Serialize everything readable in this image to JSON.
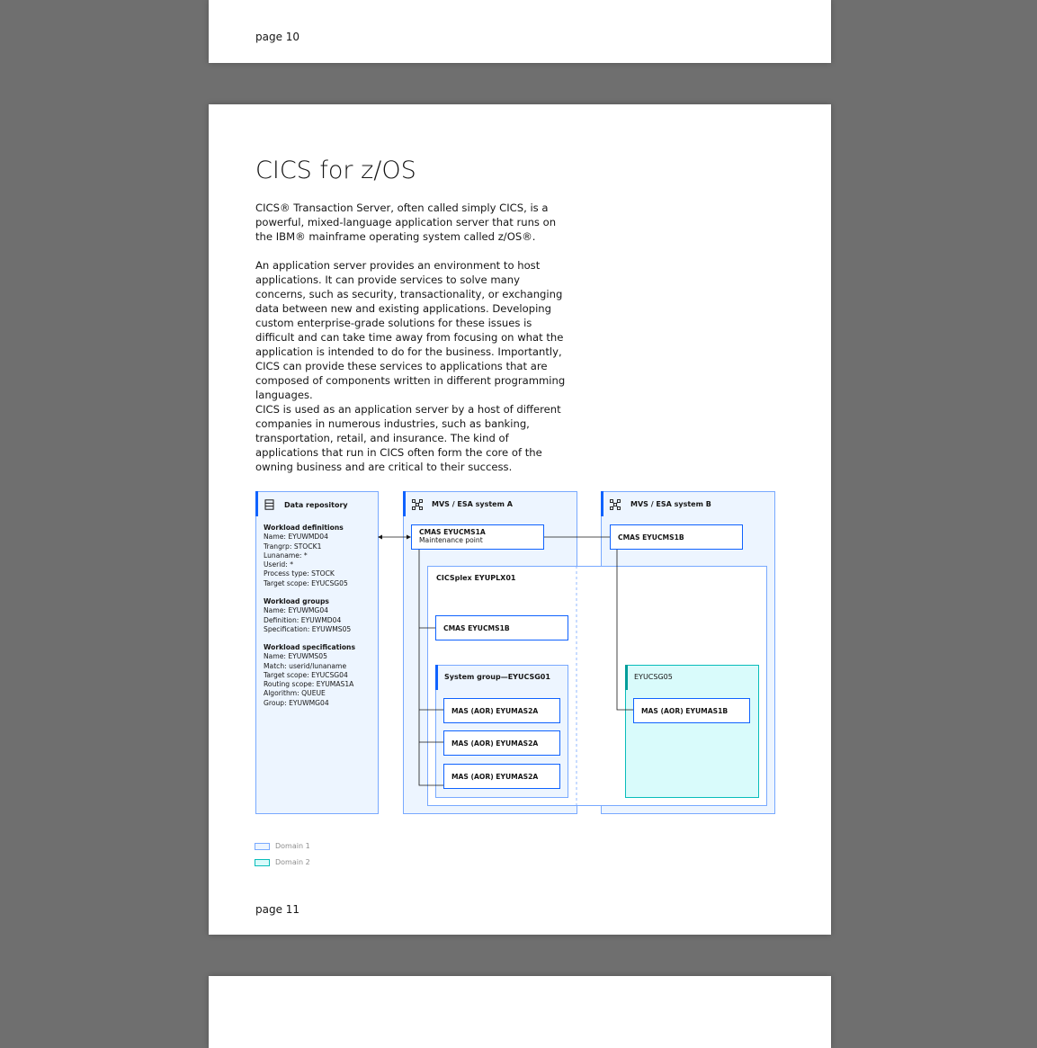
{
  "pages": {
    "prev_label": "page 10",
    "main_label": "page 11"
  },
  "doc": {
    "title": "CICS for z/OS",
    "paragraphs": [
      "CICS® Transaction Server, often called simply CICS, is a powerful, mixed-language application server that runs on the IBM® mainframe operating system called z/OS®.",
      "An application server provides an environment to host applications. It can provide services to solve many concerns, such as security, transactionality, or exchanging data between new and existing applications. Developing custom enterprise-grade solutions for these issues is difficult and can take time away from focusing on what the application is intended to do for the business. Importantly, CICS can provide these services to applications that are composed of components written in different programming languages.",
      "CICS is used as an application server by a host of different companies in numerous industries, such as banking, transportation, retail, and insurance. The kind of applications that run in CICS often form the core of the owning business and are critical to their success."
    ]
  },
  "diagram": {
    "repo": {
      "title": "Data repository",
      "icon": "database-icon",
      "sections": [
        {
          "heading": "Workload definitions",
          "lines": [
            "Name: EYUWMD04",
            "Trangrp: STOCK1",
            "Lunaname: *",
            "Userid: *",
            "Process type: STOCK",
            "Target scope: EYUCSG05"
          ]
        },
        {
          "heading": "Workload groups",
          "lines": [
            "Name: EYUWMG04",
            "Definition: EYUWMD04",
            "Specification: EYUWMS05"
          ]
        },
        {
          "heading": "Workload specifications",
          "lines": [
            "Name: EYUWMS05",
            "Match: userid/lunaname",
            "Target scope: EYUCSG04",
            "Routing scope: EYUMAS1A",
            "Algorithm: QUEUE",
            "Group: EYUWMG04"
          ]
        }
      ]
    },
    "system_a": {
      "title": "MVS / ESA system A",
      "icon": "network-icon",
      "cmas_name": "CMAS EYUCMS1A",
      "cmas_sub": "Maintenance point"
    },
    "system_b": {
      "title": "MVS / ESA system B",
      "icon": "network-icon",
      "cmas_name": "CMAS EYUCMS1B"
    },
    "cicsplex": {
      "title": "CICSplex EYUPLX01",
      "cmas": "CMAS EYUCMS1B",
      "system_group": "System group—EYUCSG01",
      "mas_a": [
        "MAS (AOR) EYUMAS2A",
        "MAS (AOR) EYUMAS2A",
        "MAS (AOR) EYUMAS2A"
      ],
      "group_b": "EYUCSG05",
      "mas_b": "MAS (AOR) EYUMAS1B"
    },
    "legend": [
      {
        "label": "Domain 1",
        "fill": "#edf5ff",
        "border": "#78a9ff"
      },
      {
        "label": "Domain 2",
        "fill": "#d9fbfb",
        "border": "#08bdba"
      }
    ]
  }
}
